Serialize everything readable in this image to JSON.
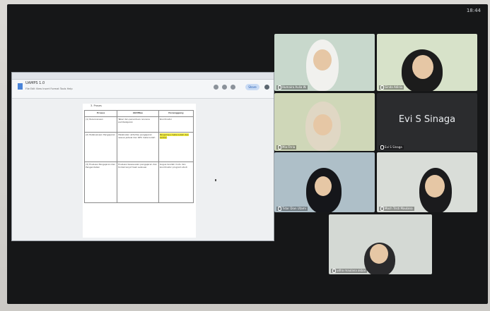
{
  "status_bar": {
    "time": "18:44"
  },
  "shared_document": {
    "title": "UAMPS 1.0",
    "menu": "File Edit View Insert Format Tools Help",
    "share_label": "Share",
    "heading": "3. Proses",
    "columns": [
      "Proses",
      "Aktifitas",
      "Penanggung"
    ],
    "rows": [
      {
        "proses": "(1) Perencanaan",
        "aktifitas": "Tabel dan penentuan rencana pembelajaran",
        "penanggung": "Koordinator",
        "highlight": false
      },
      {
        "proses": "(2) Pelaksanaan Pengajaran",
        "aktifitas": "Melakukan aktivitas pengajaran sesuai jadwal dan RPS mata kuliah",
        "penanggung": "Pengampu mata kuliah dan asisten",
        "highlight": true
      },
      {
        "proses": "(3) Evaluasi Pengajaran dan Pengendalian",
        "aktifitas": "Evaluasi kesesuaian pengajaran dan tindak lanjut hasil evaluasi",
        "penanggung": "Gugus kendali mutu dan koordinator program studi",
        "highlight": false
      }
    ]
  },
  "participants": [
    {
      "name": "Humaira Aulia W.",
      "bg": "#c8d8cc",
      "kind": "hijab-white"
    },
    {
      "name": "Ginda Adinia",
      "bg": "#d7e2c9",
      "kind": "girl"
    },
    {
      "name": "Mia Fitria",
      "bg": "#cfd7b8",
      "kind": "hijab-print"
    },
    {
      "name": "Evi S Sinaga",
      "bg": "#2b2c2e",
      "kind": "avatar-text"
    },
    {
      "name": "Tidar Dian Utami",
      "bg": "#aebfc8",
      "kind": "hijab-dark"
    },
    {
      "name": "Moch Tristi Maulana",
      "bg": "#d9ddd8",
      "kind": "man-glasses"
    },
    {
      "name": "udha maulana akbar",
      "bg": "#d4d9d4",
      "kind": "man"
    }
  ]
}
